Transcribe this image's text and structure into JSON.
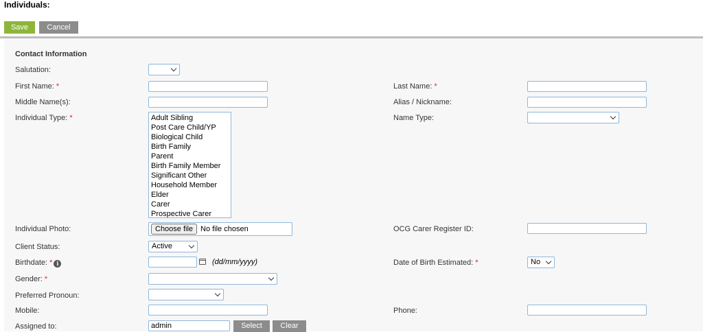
{
  "page": {
    "title": "Individuals:"
  },
  "toolbar": {
    "save_label": "Save",
    "cancel_label": "Cancel"
  },
  "section": {
    "title": "Contact Information"
  },
  "fields": {
    "salutation": {
      "label": "Salutation:",
      "value": ""
    },
    "first_name": {
      "label": "First Name:",
      "required": "*",
      "value": ""
    },
    "last_name": {
      "label": "Last Name:",
      "required": "*",
      "value": ""
    },
    "middle_names": {
      "label": "Middle Name(s):",
      "value": ""
    },
    "alias": {
      "label": "Alias / Nickname:",
      "value": ""
    },
    "individual_type": {
      "label": "Individual Type:",
      "required": "*",
      "options": [
        "Adult Sibling",
        "Post Care Child/YP",
        "Biological Child",
        "Birth Family",
        "Parent",
        "Birth Family Member",
        "Significant Other",
        "Household Member",
        "Elder",
        "Carer",
        "Prospective Carer"
      ]
    },
    "name_type": {
      "label": "Name Type:",
      "value": ""
    },
    "photo": {
      "label": "Individual Photo:",
      "button": "Choose file",
      "status": "No file chosen"
    },
    "ocg_id": {
      "label": "OCG Carer Register ID:",
      "value": ""
    },
    "client_status": {
      "label": "Client Status:",
      "value": "Active"
    },
    "birthdate": {
      "label": "Birthdate:",
      "required": "*",
      "info_icon": "i",
      "value": "",
      "hint": "(dd/mm/yyyy)"
    },
    "dob_estimated": {
      "label": "Date of Birth Estimated:",
      "required": "*",
      "value": "No"
    },
    "gender": {
      "label": "Gender:",
      "required": "*",
      "value": ""
    },
    "pronoun": {
      "label": "Preferred Pronoun:",
      "value": ""
    },
    "mobile": {
      "label": "Mobile:",
      "value": ""
    },
    "phone": {
      "label": "Phone:",
      "value": ""
    },
    "assigned_to": {
      "label": "Assigned to:",
      "value": "admin",
      "select_label": "Select",
      "clear_label": "Clear"
    }
  },
  "colors": {
    "save": "#8db53a",
    "cancel": "#8c8c8c",
    "required": "#d9241b",
    "input_border": "#8fb6db"
  }
}
